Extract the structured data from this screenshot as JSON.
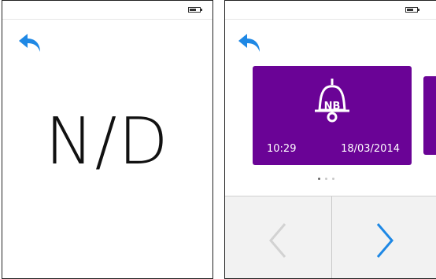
{
  "left_screen": {
    "back_icon": "back-arrow-icon",
    "battery_icon": "battery-icon",
    "value": "N/D"
  },
  "right_screen": {
    "back_icon": "back-arrow-icon",
    "battery_icon": "battery-icon",
    "card": {
      "icon": "bell-icon",
      "badge": "NB",
      "time": "10:29",
      "date": "18/03/2014",
      "color": "#6a0396"
    },
    "pager": {
      "count": 3,
      "active_index": 1
    },
    "nav": {
      "prev_icon": "chevron-left-icon",
      "next_icon": "chevron-right-icon"
    }
  },
  "colors": {
    "accent": "#1e88e5",
    "card": "#6a0396",
    "nav_background": "#f2f2f2"
  }
}
